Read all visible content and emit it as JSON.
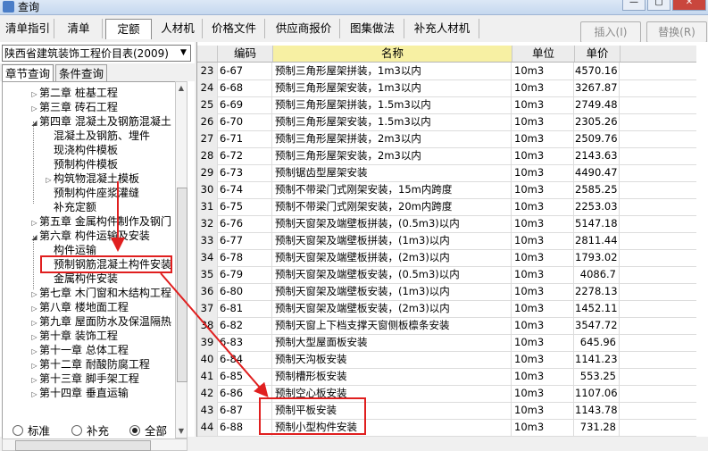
{
  "window": {
    "title": "查询"
  },
  "tabs": [
    "清单指引",
    "清单",
    "定额",
    "人材机",
    "价格文件",
    "供应商报价",
    "图集做法",
    "补充人材机"
  ],
  "active_tab": 2,
  "toolbar": {
    "insert_label": "插入(I)",
    "replace_label": "替换(R)"
  },
  "library": {
    "selected": "陕西省建筑装饰工程价目表(2009)"
  },
  "subtabs": [
    "章节查询",
    "条件查询"
  ],
  "tree": [
    {
      "label": "第二章  桩基工程",
      "level": 1,
      "twisty": "▷"
    },
    {
      "label": "第三章  砖石工程",
      "level": 1,
      "twisty": "▷"
    },
    {
      "label": "第四章  混凝土及钢筋混凝土",
      "level": 1,
      "twisty": "◢"
    },
    {
      "label": "混凝土及钢筋、埋件",
      "level": 2,
      "twisty": ""
    },
    {
      "label": "现浇构件模板",
      "level": 2,
      "twisty": ""
    },
    {
      "label": "预制构件模板",
      "level": 2,
      "twisty": ""
    },
    {
      "label": "构筑物混凝土模板",
      "level": 2,
      "twisty": "▷"
    },
    {
      "label": "预制构件座浆灌缝",
      "level": 2,
      "twisty": ""
    },
    {
      "label": "补充定额",
      "level": 2,
      "twisty": ""
    },
    {
      "label": "第五章  金属构件制作及钢门",
      "level": 1,
      "twisty": "▷"
    },
    {
      "label": "第六章  构件运输及安装",
      "level": 1,
      "twisty": "◢"
    },
    {
      "label": "构件运输",
      "level": 2,
      "twisty": ""
    },
    {
      "label": "预制钢筋混凝土构件安装",
      "level": 2,
      "twisty": ""
    },
    {
      "label": "金属构件安装",
      "level": 2,
      "twisty": ""
    },
    {
      "label": "第七章  木门窗和木结构工程",
      "level": 1,
      "twisty": "▷"
    },
    {
      "label": "第八章  楼地面工程",
      "level": 1,
      "twisty": "▷"
    },
    {
      "label": "第九章  屋面防水及保温隔热",
      "level": 1,
      "twisty": "▷"
    },
    {
      "label": "第十章  装饰工程",
      "level": 1,
      "twisty": "▷"
    },
    {
      "label": "第十一章  总体工程",
      "level": 1,
      "twisty": "▷"
    },
    {
      "label": "第十二章  耐酸防腐工程",
      "level": 1,
      "twisty": "▷"
    },
    {
      "label": "第十三章  脚手架工程",
      "level": 1,
      "twisty": "▷"
    },
    {
      "label": "第十四章  垂直运输",
      "level": 1,
      "twisty": "▷"
    }
  ],
  "radios": [
    {
      "label": "标准",
      "checked": false
    },
    {
      "label": "补充",
      "checked": false
    },
    {
      "label": "全部",
      "checked": true
    }
  ],
  "grid": {
    "headers": [
      "",
      "编码",
      "名称",
      "单位",
      "单价"
    ],
    "rows": [
      [
        "23",
        "6-67",
        "预制三角形屋架拼装，1m3以内",
        "10m3",
        "4570.16"
      ],
      [
        "24",
        "6-68",
        "预制三角形屋架安装，1m3以内",
        "10m3",
        "3267.87"
      ],
      [
        "25",
        "6-69",
        "预制三角形屋架拼装，1.5m3以内",
        "10m3",
        "2749.48"
      ],
      [
        "26",
        "6-70",
        "预制三角形屋架安装，1.5m3以内",
        "10m3",
        "2305.26"
      ],
      [
        "27",
        "6-71",
        "预制三角形屋架拼装，2m3以内",
        "10m3",
        "2509.76"
      ],
      [
        "28",
        "6-72",
        "预制三角形屋架安装，2m3以内",
        "10m3",
        "2143.63"
      ],
      [
        "29",
        "6-73",
        "预制锯齿型屋架安装",
        "10m3",
        "4490.47"
      ],
      [
        "30",
        "6-74",
        "预制不带梁门式刚架安装，15m内跨度",
        "10m3",
        "2585.25"
      ],
      [
        "31",
        "6-75",
        "预制不带梁门式刚架安装，20m内跨度",
        "10m3",
        "2253.03"
      ],
      [
        "32",
        "6-76",
        "预制天窗架及端壁板拼装，(0.5m3)以内",
        "10m3",
        "5147.18"
      ],
      [
        "33",
        "6-77",
        "预制天窗架及端壁板拼装，(1m3)以内",
        "10m3",
        "2811.44"
      ],
      [
        "34",
        "6-78",
        "预制天窗架及端壁板拼装，(2m3)以内",
        "10m3",
        "1793.02"
      ],
      [
        "35",
        "6-79",
        "预制天窗架及端壁板安装，(0.5m3)以内",
        "10m3",
        "4086.7"
      ],
      [
        "36",
        "6-80",
        "预制天窗架及端壁板安装，(1m3)以内",
        "10m3",
        "2278.13"
      ],
      [
        "37",
        "6-81",
        "预制天窗架及端壁板安装，(2m3)以内",
        "10m3",
        "1452.11"
      ],
      [
        "38",
        "6-82",
        "预制天窗上下档支撑天窗侧板檩条安装",
        "10m3",
        "3547.72"
      ],
      [
        "39",
        "6-83",
        "预制大型屋面板安装",
        "10m3",
        "645.96"
      ],
      [
        "40",
        "6-84",
        "预制天沟板安装",
        "10m3",
        "1141.23"
      ],
      [
        "41",
        "6-85",
        "预制槽形板安装",
        "10m3",
        "553.25"
      ],
      [
        "42",
        "6-86",
        "预制空心板安装",
        "10m3",
        "1107.06"
      ],
      [
        "43",
        "6-87",
        "预制平板安装",
        "10m3",
        "1143.78"
      ],
      [
        "44",
        "6-88",
        "预制小型构件安装",
        "10m3",
        "731.28"
      ]
    ]
  },
  "colors": {
    "highlight_box": "#e01f1f",
    "name_header": "#f7f0a3",
    "arrow": "#e01f1f"
  }
}
